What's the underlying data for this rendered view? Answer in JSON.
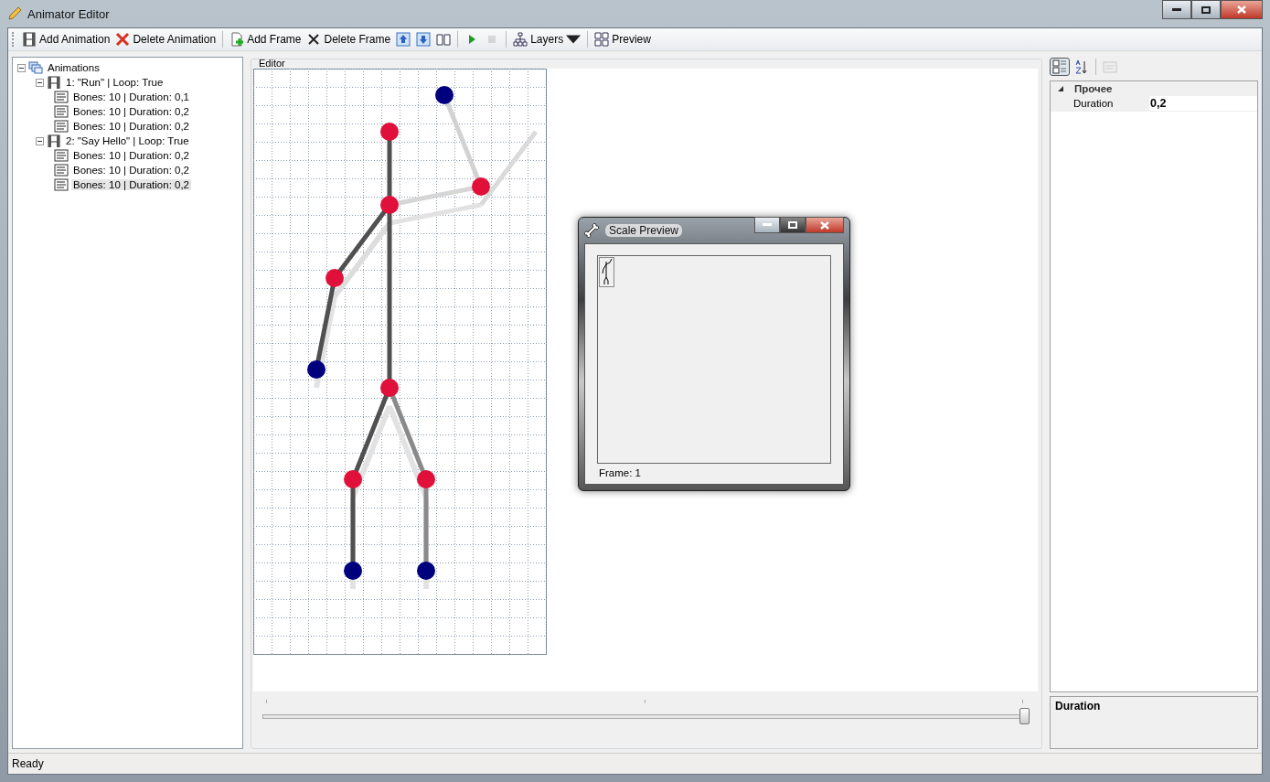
{
  "window": {
    "title": "Animator Editor"
  },
  "toolbar": {
    "groups": [
      {
        "items": [
          {
            "kind": "button",
            "label": "Add Animation",
            "disabled": false
          },
          {
            "kind": "button",
            "label": "Delete Animation",
            "disabled": false
          }
        ]
      },
      {
        "items": [
          {
            "kind": "button",
            "label": "Add Frame",
            "disabled": false
          },
          {
            "kind": "button",
            "label": "Delete Frame",
            "disabled": false
          },
          {
            "kind": "icon",
            "disabled": false
          },
          {
            "kind": "icon",
            "disabled": false
          },
          {
            "kind": "icon",
            "disabled": false
          }
        ]
      },
      {
        "items": [
          {
            "kind": "icon",
            "disabled": false
          },
          {
            "kind": "icon",
            "disabled": true
          }
        ]
      },
      {
        "items": [
          {
            "kind": "dropdown",
            "label": "Layers",
            "disabled": false
          }
        ]
      },
      {
        "items": [
          {
            "kind": "button",
            "label": "Preview",
            "disabled": false
          }
        ]
      }
    ]
  },
  "tree": [
    {
      "label": "Animations",
      "expanded": true,
      "selected": false,
      "children": [
        {
          "label": "1: \"Run\" | Loop: True",
          "expanded": true,
          "selected": false,
          "children": [
            {
              "label": "Bones: 10 | Duration: 0,1",
              "selected": false
            },
            {
              "label": "Bones: 10 | Duration: 0,2",
              "selected": false
            },
            {
              "label": "Bones: 10 | Duration: 0,2",
              "selected": false
            }
          ]
        },
        {
          "label": "2: \"Say Hello\" | Loop: True",
          "expanded": true,
          "selected": false,
          "children": [
            {
              "label": "Bones: 10 | Duration: 0,2",
              "selected": false
            },
            {
              "label": "Bones: 10 | Duration: 0,2",
              "selected": false
            },
            {
              "label": "Bones: 10 | Duration: 0,2",
              "selected": true
            }
          ]
        }
      ]
    }
  ],
  "editor": {
    "title": "Editor",
    "timeline": {
      "level": 1.0
    }
  },
  "preview_window": {
    "title": "Scale Preview",
    "frame_label": "Frame: 1"
  },
  "properties": {
    "toolbar": [
      {
        "selected": true,
        "disabled": false
      },
      {
        "selected": false,
        "disabled": false
      },
      {
        "selected": false,
        "disabled": true
      }
    ],
    "categories": [
      {
        "name": "Прочее",
        "expanded": true,
        "properties": [
          {
            "name": "Duration",
            "value": "0,2"
          }
        ]
      }
    ],
    "description": {
      "title": "Duration"
    }
  },
  "status_bar": {
    "text": "Ready"
  }
}
